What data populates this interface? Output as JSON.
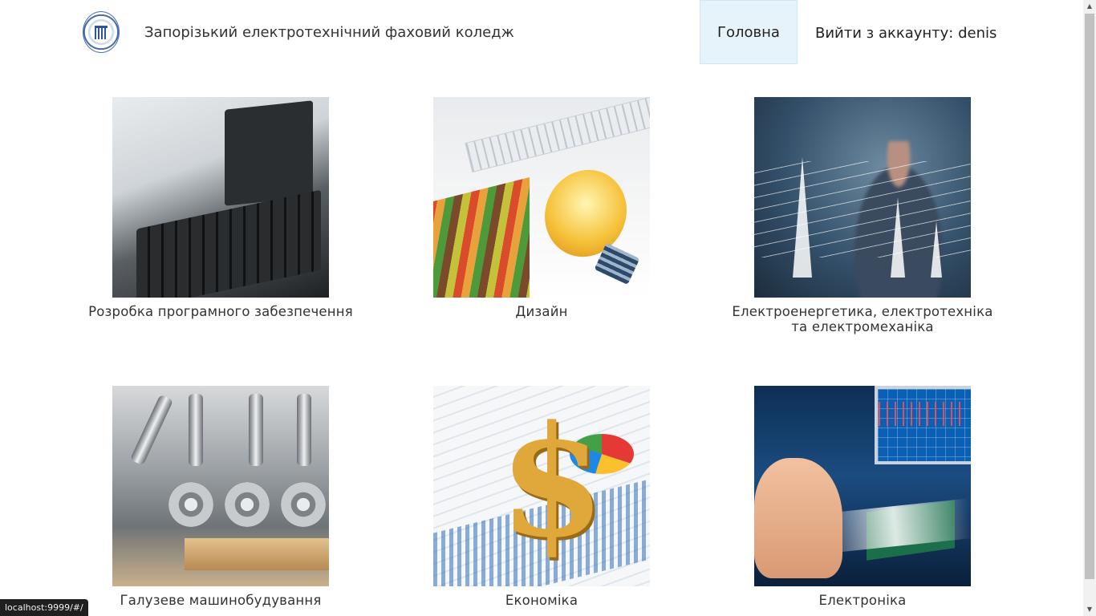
{
  "header": {
    "title": "Запорізький електротехнічний фаховий коледж",
    "logo_icon": "college-emblem-icon",
    "nav": {
      "home": "Головна",
      "logout": "Вийти з аккаунту: denis"
    }
  },
  "specialties": [
    {
      "caption": "Розробка програмного забезпечення",
      "image": "computer-keyboard-image"
    },
    {
      "caption": "Дизайн",
      "image": "pencils-lightbulb-image"
    },
    {
      "caption": "Електроенергетика, електротехніка\nта електромеханіка",
      "image": "power-lines-image"
    },
    {
      "caption": "Галузеве машинобудування",
      "image": "machinery-image"
    },
    {
      "caption": "Економіка",
      "image": "dollar-charts-image"
    },
    {
      "caption": "Електроніка",
      "image": "oscilloscope-image"
    }
  ],
  "status_bar": {
    "url": "localhost:9999/#/"
  },
  "colors": {
    "nav_active_bg": "#e6f3fb",
    "text": "#333333",
    "status_bg": "#1f1f1f"
  }
}
